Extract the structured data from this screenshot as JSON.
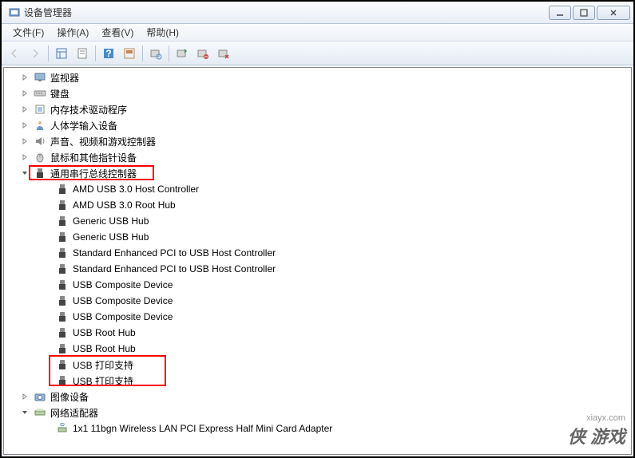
{
  "window": {
    "title": "设备管理器"
  },
  "menubar": {
    "items": [
      {
        "label": "文件(F)"
      },
      {
        "label": "操作(A)"
      },
      {
        "label": "查看(V)"
      },
      {
        "label": "帮助(H)"
      }
    ]
  },
  "tree": {
    "categories": [
      {
        "label": "监视器",
        "icon": "monitor",
        "expanded": false,
        "indent": 0
      },
      {
        "label": "键盘",
        "icon": "keyboard",
        "expanded": false,
        "indent": 0
      },
      {
        "label": "内存技术驱动程序",
        "icon": "memory",
        "expanded": false,
        "indent": 0
      },
      {
        "label": "人体学输入设备",
        "icon": "hid",
        "expanded": false,
        "indent": 0
      },
      {
        "label": "声音、视频和游戏控制器",
        "icon": "sound",
        "expanded": false,
        "indent": 0
      },
      {
        "label": "鼠标和其他指针设备",
        "icon": "mouse",
        "expanded": false,
        "indent": 0
      },
      {
        "label": "通用串行总线控制器",
        "icon": "usb",
        "expanded": true,
        "indent": 0,
        "children": [
          {
            "label": "AMD USB 3.0 Host Controller",
            "icon": "usb-device"
          },
          {
            "label": "AMD USB 3.0 Root Hub",
            "icon": "usb-device"
          },
          {
            "label": "Generic USB Hub",
            "icon": "usb-device"
          },
          {
            "label": "Generic USB Hub",
            "icon": "usb-device"
          },
          {
            "label": "Standard Enhanced PCI to USB Host Controller",
            "icon": "usb-device"
          },
          {
            "label": "Standard Enhanced PCI to USB Host Controller",
            "icon": "usb-device"
          },
          {
            "label": "USB Composite Device",
            "icon": "usb-device"
          },
          {
            "label": "USB Composite Device",
            "icon": "usb-device"
          },
          {
            "label": "USB Composite Device",
            "icon": "usb-device"
          },
          {
            "label": "USB Root Hub",
            "icon": "usb-device"
          },
          {
            "label": "USB Root Hub",
            "icon": "usb-device"
          },
          {
            "label": "USB 打印支持",
            "icon": "usb-device"
          },
          {
            "label": "USB 打印支持",
            "icon": "usb-device"
          }
        ]
      },
      {
        "label": "图像设备",
        "icon": "imaging",
        "expanded": false,
        "indent": 0
      },
      {
        "label": "网络适配器",
        "icon": "network",
        "expanded": true,
        "indent": 0,
        "children": [
          {
            "label": "1x1 11bgn Wireless LAN PCI Express Half Mini Card Adapter",
            "icon": "network-device"
          }
        ]
      }
    ]
  },
  "watermark": {
    "site": "xiayx.com",
    "brand": "侠 游戏"
  }
}
